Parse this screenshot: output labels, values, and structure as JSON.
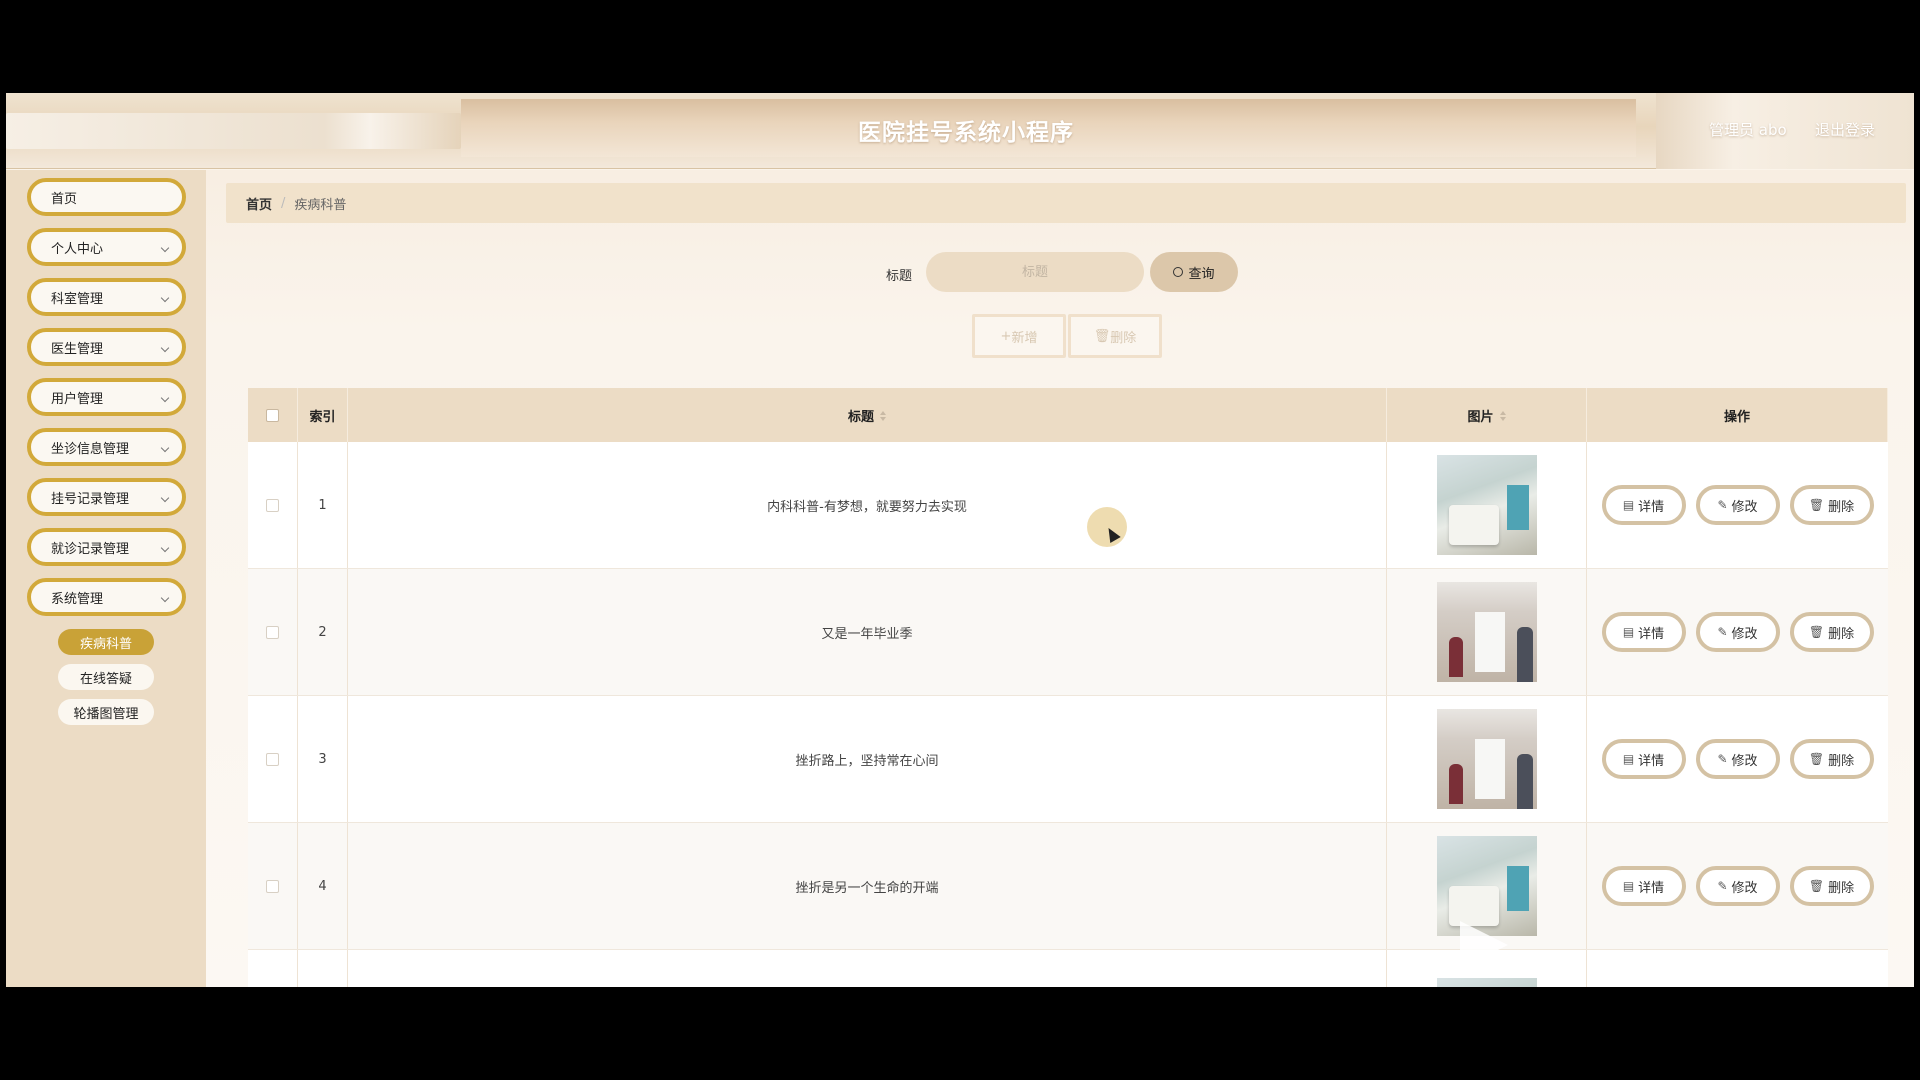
{
  "header": {
    "title": "医院挂号系统小程序",
    "user": "管理员 abo",
    "logout": "退出登录"
  },
  "sidebar": {
    "items": [
      {
        "label": "首页",
        "has_children": false
      },
      {
        "label": "个人中心",
        "has_children": true
      },
      {
        "label": "科室管理",
        "has_children": true
      },
      {
        "label": "医生管理",
        "has_children": true
      },
      {
        "label": "用户管理",
        "has_children": true
      },
      {
        "label": "坐诊信息管理",
        "has_children": true
      },
      {
        "label": "挂号记录管理",
        "has_children": true
      },
      {
        "label": "就诊记录管理",
        "has_children": true
      },
      {
        "label": "系统管理",
        "has_children": true
      }
    ],
    "subitems": [
      {
        "label": "疾病科普",
        "active": true
      },
      {
        "label": "在线答疑",
        "active": false
      },
      {
        "label": "轮播图管理",
        "active": false
      }
    ]
  },
  "breadcrumb": {
    "home": "首页",
    "separator": "/",
    "current": "疾病科普"
  },
  "search": {
    "label": "标题",
    "placeholder": "标题",
    "button": "查询"
  },
  "actions": {
    "add": "新增",
    "delete": "删除"
  },
  "table": {
    "columns": [
      "索引",
      "标题",
      "图片",
      "操作"
    ],
    "rows": [
      {
        "index": "1",
        "title": "内科科普-有梦想，就要努力去实现",
        "image": "ward"
      },
      {
        "index": "2",
        "title": "又是一年毕业季",
        "image": "hall"
      },
      {
        "index": "3",
        "title": "挫折路上，坚持常在心间",
        "image": "hall"
      },
      {
        "index": "4",
        "title": "挫折是另一个生命的开端",
        "image": "ward"
      }
    ],
    "row_actions": {
      "detail": "详情",
      "edit": "修改",
      "delete": "删除"
    }
  },
  "colors": {
    "accent": "#d2a93a",
    "active_sub": "#c9a237",
    "header_bg": "#e8d5bb",
    "table_head": "#ecdcc5"
  }
}
